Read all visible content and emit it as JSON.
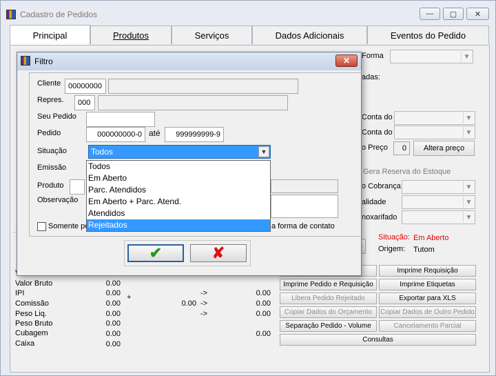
{
  "window": {
    "title": "Cadastro de Pedidos",
    "minimize": "—",
    "maximize": "▢",
    "close": "✕"
  },
  "tabs": [
    "Principal",
    "Produtos",
    "Serviços",
    "Dados Adicionais",
    "Eventos do Pedido"
  ],
  "background": {
    "forma_label": "Forma",
    "adas_label": "adas:",
    "conta1_label": "Conta do",
    "conta2_label": "Conta do",
    "preco_label": "o Preço",
    "preco_value": "0",
    "altera_preco": "Altera preço",
    "gera_reserva": "Gera Reserva do Estoque",
    "cobranca_label": "o Cobrança",
    "alidade_label": "alidade",
    "noxarifado_label": "noxarifado",
    "situacao_label": "Situação:",
    "situacao_value": "Em Aberto",
    "origem_label": "Origem:",
    "origem_value": "Tutom",
    "s_btn": "s"
  },
  "actions": [
    {
      "label": "Imprime Requisição",
      "enabled": true
    },
    {
      "label": "Imprime Pedido e Requisição",
      "enabled": true
    },
    {
      "label": "Imprime Etiquetas",
      "enabled": true
    },
    {
      "label": "Libera Pedido Rejeitado",
      "enabled": false
    },
    {
      "label": "Exportar para XLS",
      "enabled": true
    },
    {
      "label": "Copiar Dados do Orçamento",
      "enabled": false
    },
    {
      "label": "Copiar Dados de Outro Pedido",
      "enabled": false
    },
    {
      "label": "Separação Pedido - Volume",
      "enabled": true
    },
    {
      "label": "Cancelamento Parcial",
      "enabled": false
    },
    {
      "label": "Consultas",
      "enabled": true
    }
  ],
  "totals": {
    "v_label": "V",
    "rows": [
      {
        "label": "Valor Bruto",
        "value": "0.00"
      },
      {
        "label": "IPI",
        "value": "0.00"
      },
      {
        "label": "Comissão",
        "value": "0.00"
      },
      {
        "label": "Peso Liq.",
        "value": "0.00"
      },
      {
        "label": "Peso Bruto",
        "value": "0.00"
      },
      {
        "label": "Cubagem",
        "value": "0.00"
      },
      {
        "label": "Caixa",
        "value": "0.00"
      }
    ],
    "plus": "+",
    "mid_value": "0.00",
    "arrows": [
      "->",
      "->",
      "->"
    ],
    "right_values": [
      "0.00",
      "0.00",
      "0.00",
      "0.00"
    ]
  },
  "filtro": {
    "title": "Filtro",
    "cliente_label": "Cliente",
    "cliente_code": "00000000",
    "repres_label": "Repres.",
    "repres_code": "000",
    "seu_pedido_label": "Seu Pedido",
    "pedido_label": "Pedido",
    "pedido_from": "000000000-0",
    "ate_label": "até",
    "pedido_to": "999999999-9",
    "situacao_label": "Situação",
    "situacao_value": "Todos",
    "emissao_label": "Emissão",
    "produto_label": "Produto",
    "observacao_label": "Observação",
    "somente_label": "Somente pe",
    "contato_label": "a forma de contato",
    "options": [
      "Todos",
      "Em Aberto",
      "Parc. Atendidos",
      "Em Aberto + Parc. Atend.",
      "Atendidos",
      "Rejeitados"
    ],
    "highlighted_option": "Rejeitados",
    "ok_glyph": "✔",
    "cancel_glyph": "✘"
  },
  "colors": {
    "accent": "#3399ff",
    "status_red": "#e00000",
    "ok_green": "#1b9a1b",
    "cancel_red": "#e01010"
  }
}
